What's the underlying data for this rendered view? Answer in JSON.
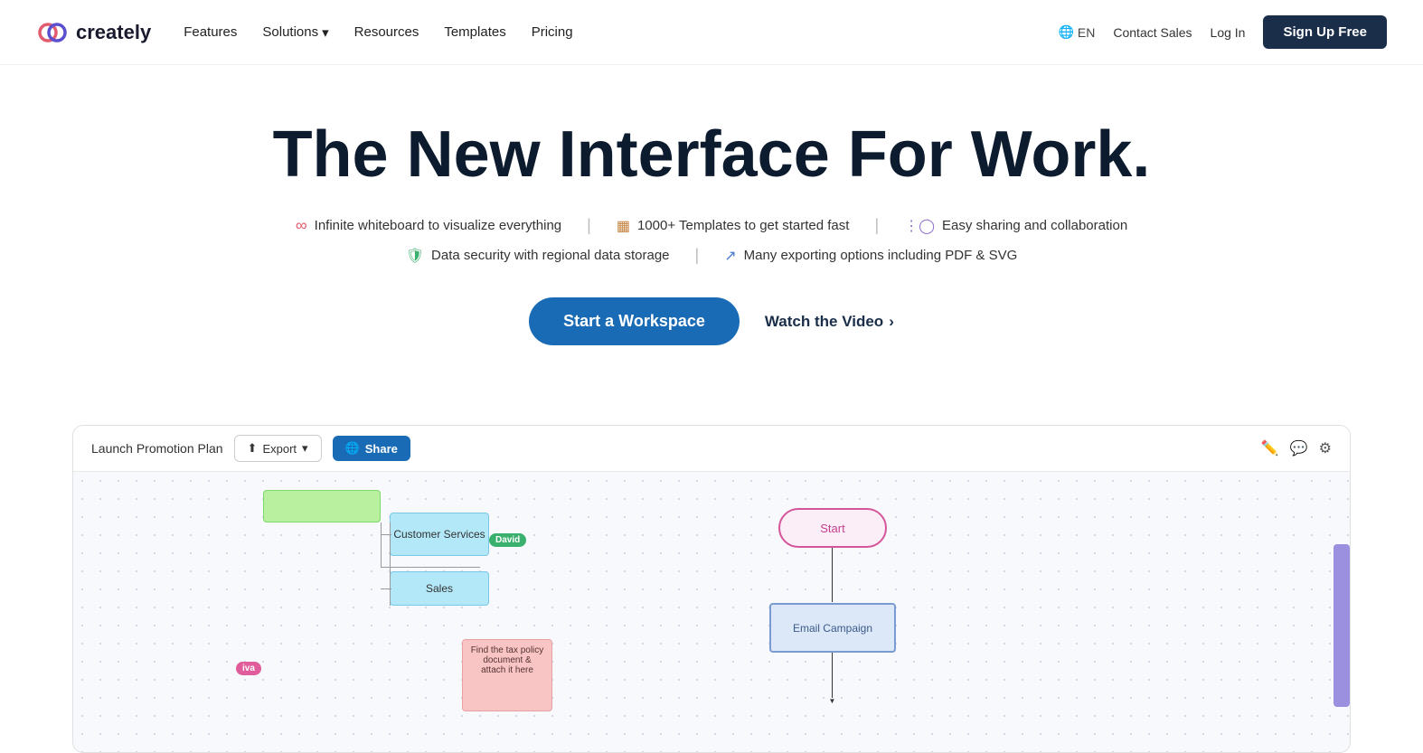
{
  "nav": {
    "logo_text": "creately",
    "links": [
      {
        "label": "Features",
        "has_dropdown": false
      },
      {
        "label": "Solutions",
        "has_dropdown": true
      },
      {
        "label": "Resources",
        "has_dropdown": false
      },
      {
        "label": "Templates",
        "has_dropdown": false
      },
      {
        "label": "Pricing",
        "has_dropdown": false
      }
    ],
    "lang": "EN",
    "contact_label": "Contact Sales",
    "login_label": "Log In",
    "signup_label": "Sign Up Free"
  },
  "hero": {
    "title": "The New Interface For Work.",
    "features": [
      {
        "icon": "infinite",
        "text": "Infinite whiteboard to visualize everything"
      },
      {
        "icon": "templates",
        "text": "1000+ Templates to get started fast"
      },
      {
        "icon": "share",
        "text": "Easy sharing and collaboration"
      },
      {
        "icon": "shield",
        "text": "Data security with regional data storage"
      },
      {
        "icon": "export",
        "text": "Many exporting options including PDF & SVG"
      }
    ],
    "cta_primary": "Start a Workspace",
    "cta_secondary": "Watch the Video"
  },
  "canvas": {
    "name": "Launch Promotion Plan",
    "export_label": "Export",
    "share_label": "Share",
    "nodes": {
      "customer_services": "Customer Services",
      "sales": "Sales",
      "david_badge": "David",
      "start_label": "Start",
      "email_campaign": "Email Campaign",
      "note_text": "Find the tax policy document & attach it here",
      "iva_badge": "iva"
    }
  }
}
